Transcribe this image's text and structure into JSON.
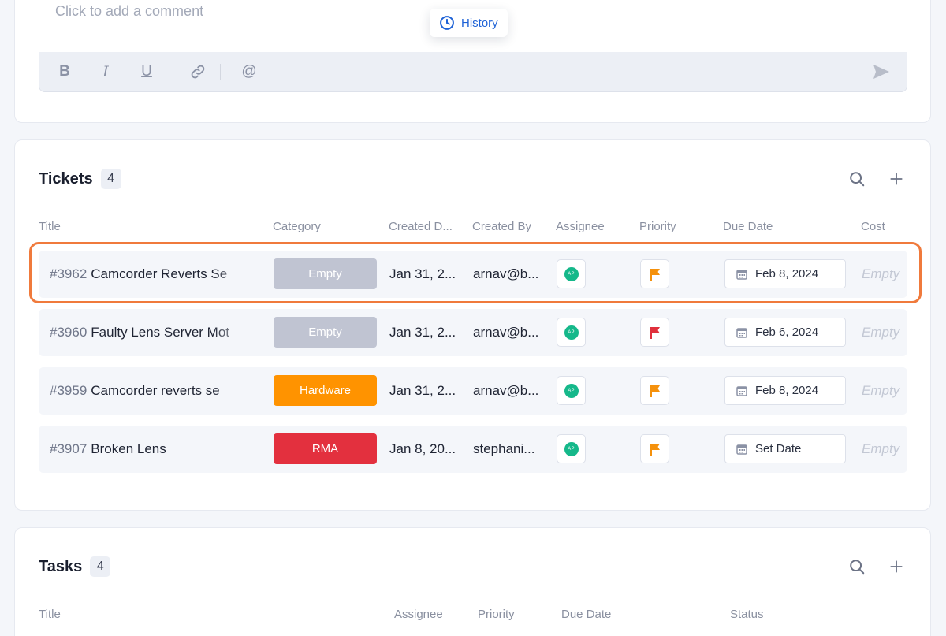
{
  "comment": {
    "placeholder": "Click to add a comment",
    "toolbar": {
      "bold": "B",
      "italic": "I",
      "underline": "U",
      "mention": "@"
    }
  },
  "history": {
    "label": "History"
  },
  "tickets": {
    "title": "Tickets",
    "count": "4",
    "columns": [
      "Title",
      "Category",
      "Created D...",
      "Created By",
      "Assignee",
      "Priority",
      "Due Date",
      "Cost"
    ],
    "rows": [
      {
        "id": "#3962",
        "title": "Camcorder Reverts Se",
        "category": "Empty",
        "category_color": "#c0c4d2",
        "created_date": "Jan 31, 2...",
        "created_by": "arnav@b...",
        "assignee_initials": "AP",
        "priority_color": "#f5910c",
        "due_date": "Feb 8, 2024",
        "cost": "Empty"
      },
      {
        "id": "#3960",
        "title": "Faulty Lens Server Mot",
        "category": "Empty",
        "category_color": "#c0c4d2",
        "created_date": "Jan 31, 2...",
        "created_by": "arnav@b...",
        "assignee_initials": "AP",
        "priority_color": "#e0303c",
        "due_date": "Feb 6, 2024",
        "cost": "Empty"
      },
      {
        "id": "#3959",
        "title": "Camcorder reverts se",
        "category": "Hardware",
        "category_color": "#ff9300",
        "created_date": "Jan 31, 2...",
        "created_by": "arnav@b...",
        "assignee_initials": "AP",
        "priority_color": "#f5910c",
        "due_date": "Feb 8, 2024",
        "cost": "Empty"
      },
      {
        "id": "#3907",
        "title": "Broken Lens",
        "category": "RMA",
        "category_color": "#e3303e",
        "created_date": "Jan 8, 20...",
        "created_by": "stephani...",
        "assignee_initials": "AP",
        "priority_color": "#f5910c",
        "due_date": "Set Date",
        "cost": "Empty"
      }
    ]
  },
  "tasks": {
    "title": "Tasks",
    "count": "4",
    "columns": [
      "Title",
      "Assignee",
      "Priority",
      "Due Date",
      "Status"
    ]
  },
  "colors": {
    "accent": "#1e62d6",
    "highlight": "#f07a3c",
    "avatar": "#15b88a"
  },
  "icons": {
    "history": "clock-icon",
    "search": "search-icon",
    "add": "plus-icon",
    "send": "send-icon",
    "link": "link-icon",
    "calendar": "calendar-icon",
    "priority": "flag-icon"
  }
}
